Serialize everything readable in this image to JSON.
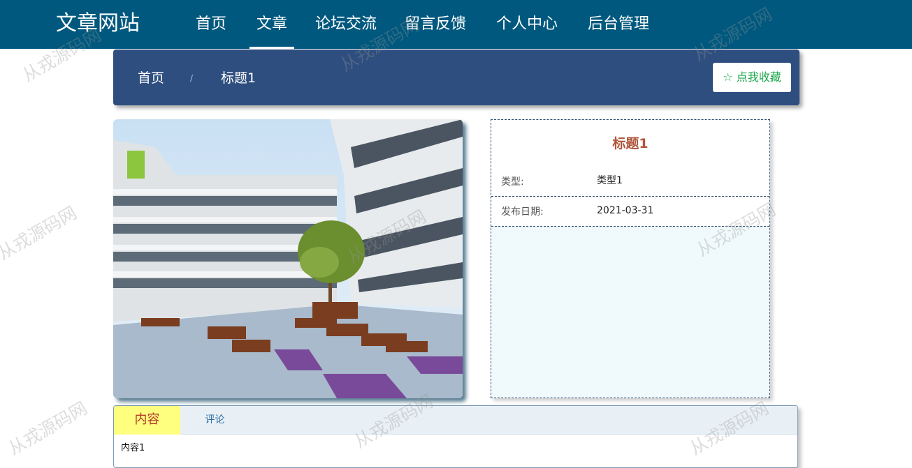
{
  "nav": {
    "logo": "文章网站",
    "items": [
      {
        "label": "首页"
      },
      {
        "label": "文章",
        "active": true
      },
      {
        "label": "论坛交流"
      },
      {
        "label": "留言反馈"
      },
      {
        "label": "个人中心"
      },
      {
        "label": "后台管理"
      }
    ]
  },
  "breadcrumb": {
    "home": "首页",
    "separator": "/",
    "current": "标题1"
  },
  "favorite_button": {
    "icon": "star-outline-icon",
    "label": "☆ 点我收藏"
  },
  "detail": {
    "title": "标题1",
    "fields": [
      {
        "key": "类型:",
        "value": "类型1"
      },
      {
        "key": "发布日期:",
        "value": "2021-03-31"
      }
    ]
  },
  "tabs": {
    "items": [
      "内容",
      "评论"
    ],
    "active": "内容",
    "body": "内容1"
  },
  "watermark": "从戎源码网",
  "colors": {
    "nav": "#00587e",
    "crumbbar": "#2e4e7f",
    "fav": "#1aa84b",
    "title": "#b0553a",
    "active_tab": "#ffff7f"
  }
}
